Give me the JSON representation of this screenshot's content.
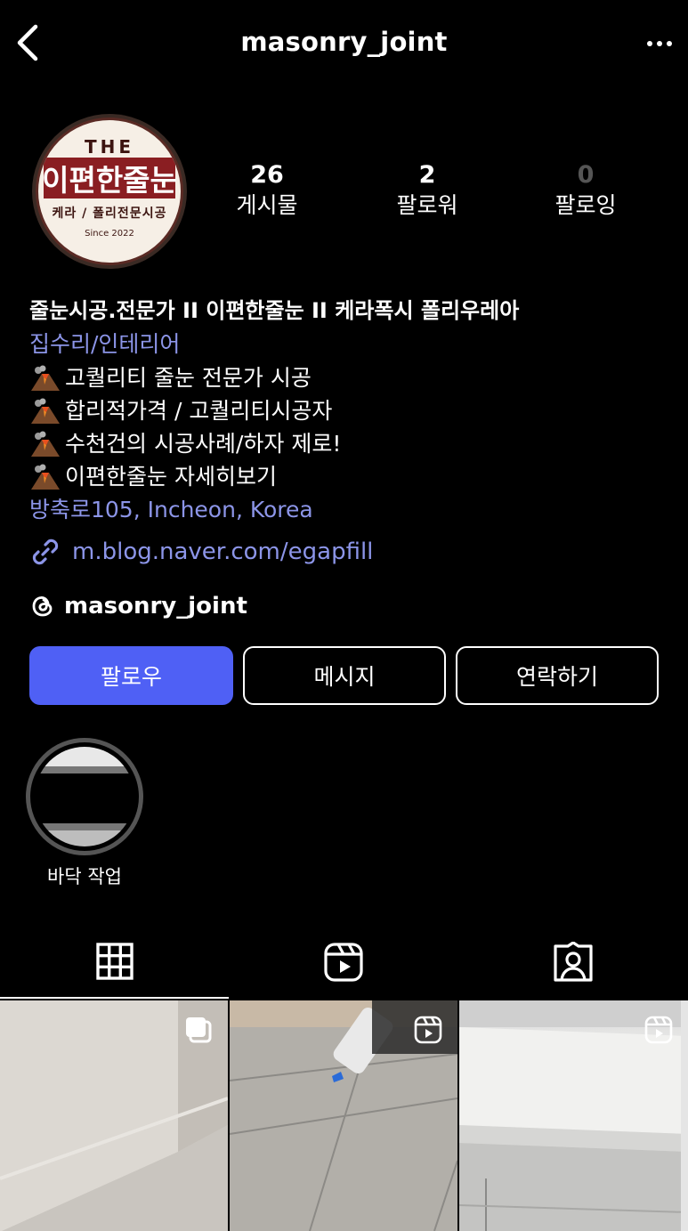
{
  "header": {
    "title": "masonry_joint"
  },
  "avatar": {
    "logo_top": "THE",
    "logo_main": "이편한줄눈",
    "logo_sub": "케라 / 폴리전문시공",
    "logo_since": "Since 2022"
  },
  "stats": {
    "posts": {
      "value": "26",
      "label": "게시물"
    },
    "followers": {
      "value": "2",
      "label": "팔로워"
    },
    "following": {
      "value": "0",
      "label": "팔로잉"
    }
  },
  "bio": {
    "name": "줄눈시공.전문가 II 이편한줄눈 II 케라폭시 폴리우레아",
    "category": "집수리/인테리어",
    "lines": [
      "고퀄리티 줄눈 전문가 시공",
      "합리적가격 / 고퀄리티시공자",
      "수천건의 시공사례/하자 제로!",
      "이편한줄눈 자세히보기"
    ],
    "location": "방축로105, Incheon, Korea",
    "link": "m.blog.naver.com/egapfill",
    "threads": "masonry_joint"
  },
  "buttons": {
    "follow": "팔로우",
    "message": "메시지",
    "contact": "연락하기"
  },
  "highlights": [
    {
      "label": "바닥 작업"
    }
  ],
  "tabs": [
    "grid-icon",
    "reels-icon",
    "tagged-icon"
  ],
  "posts": [
    {
      "type": "carousel",
      "icon": "carousel-icon"
    },
    {
      "type": "reel",
      "icon": "reel-icon"
    },
    {
      "type": "reel",
      "icon": "reel-icon"
    }
  ],
  "colors": {
    "accent": "#4f60f5",
    "link": "#8c95e8",
    "background": "#000000"
  }
}
